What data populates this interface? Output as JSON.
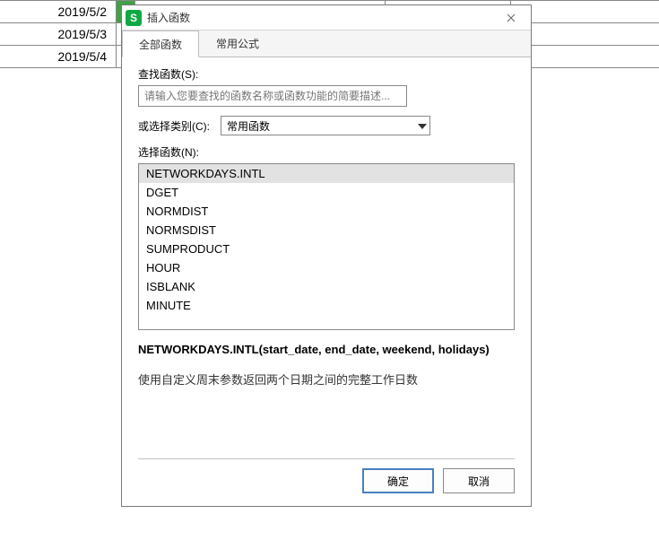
{
  "sheet": {
    "rows": [
      {
        "date": "2019/5/2"
      },
      {
        "date": "2019/5/3"
      },
      {
        "date": "2019/5/4"
      }
    ]
  },
  "dialog": {
    "title": "插入函数",
    "tabs": {
      "all": "全部函数",
      "common": "常用公式"
    },
    "search_label": "查找函数(S):",
    "search_placeholder": "请输入您要查找的函数名称或函数功能的简要描述...",
    "category_label": "或选择类别(C):",
    "category_value": "常用函数",
    "list_label": "选择函数(N):",
    "functions": [
      "NETWORKDAYS.INTL",
      "DGET",
      "NORMDIST",
      "NORMSDIST",
      "SUMPRODUCT",
      "HOUR",
      "ISBLANK",
      "MINUTE"
    ],
    "signature": "NETWORKDAYS.INTL(start_date, end_date, weekend, holidays)",
    "description": "使用自定义周末参数返回两个日期之间的完整工作日数",
    "buttons": {
      "ok": "确定",
      "cancel": "取消"
    }
  }
}
